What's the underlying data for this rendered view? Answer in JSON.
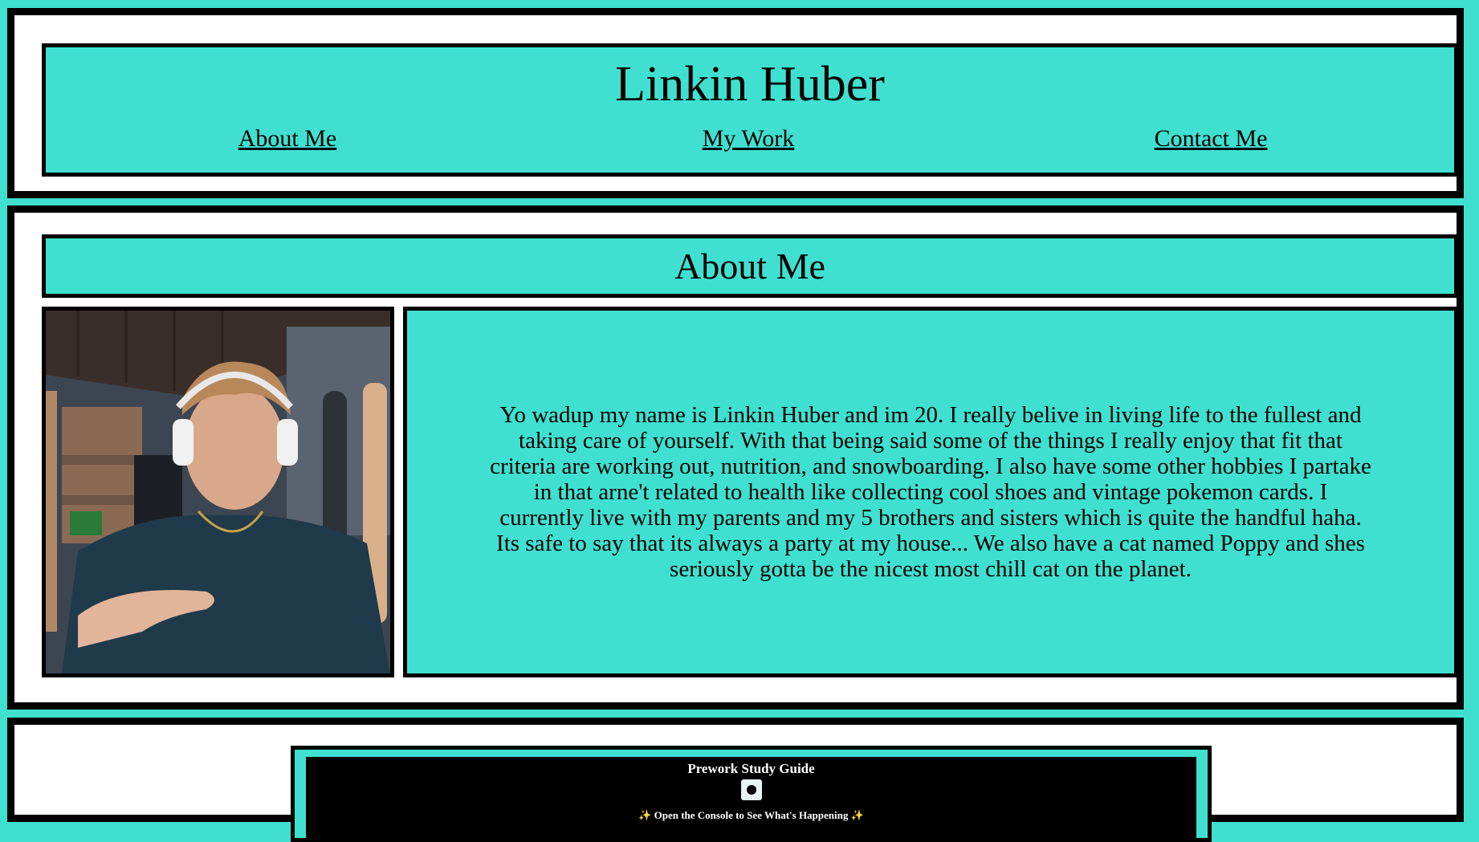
{
  "header": {
    "title": "Linkin Huber",
    "nav": [
      {
        "label": "About Me"
      },
      {
        "label": "My Work"
      },
      {
        "label": "Contact Me"
      }
    ]
  },
  "about": {
    "heading": "About Me",
    "bio": "Yo wadup my name is Linkin Huber and im 20. I really belive in living life to the fullest and taking care of yourself. With that being said some of the things I really enjoy that fit that criteria are working out, nutrition, and snowboarding. I also have some other hobbies I partake in that arne't related to health like collecting cool shoes and vintage pokemon cards. I currently live with my parents and my 5 brothers and sisters which is quite the handful haha. Its safe to say that its always a party at my house... We also have a cat named Poppy and shes seriously gotta be the nicest most chill cat on the planet."
  },
  "work": {
    "card_title": "Prework Study Guide",
    "card_subtitle": "✨ Open the Console to See What's Happening ✨"
  },
  "colors": {
    "accent": "#40E0D0",
    "border": "#000000",
    "panel": "#ffffff"
  }
}
